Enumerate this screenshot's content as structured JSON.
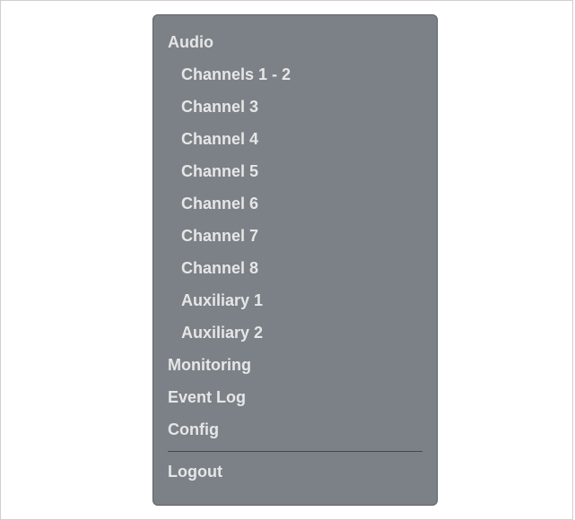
{
  "menu": {
    "audio_label": "Audio",
    "channels": [
      "Channels 1 - 2",
      "Channel 3",
      "Channel 4",
      "Channel 5",
      "Channel 6",
      "Channel 7",
      "Channel 8",
      "Auxiliary 1",
      "Auxiliary 2"
    ],
    "monitoring_label": "Monitoring",
    "event_log_label": "Event Log",
    "config_label": "Config",
    "logout_label": "Logout"
  },
  "colors": {
    "menu_background": "#7b8187",
    "menu_text": "#e6e6e6",
    "divider": "#44484c"
  }
}
